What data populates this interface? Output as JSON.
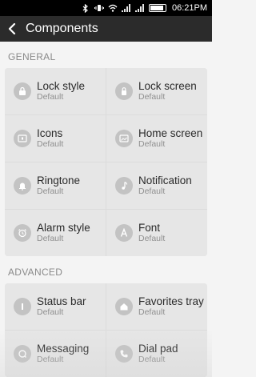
{
  "status_bar": {
    "time": "06:21PM",
    "icons": [
      "bluetooth-icon",
      "vibrate-icon",
      "wifi-icon",
      "signal-icon",
      "signal-icon",
      "battery-icon"
    ]
  },
  "header": {
    "title": "Components",
    "back_icon": "chevron-left-icon"
  },
  "sections": [
    {
      "label": "GENERAL",
      "items": [
        {
          "label": "Lock style",
          "sub": "Default",
          "icon": "lock-icon"
        },
        {
          "label": "Lock screen",
          "sub": "Default",
          "icon": "lock-screen-icon"
        },
        {
          "label": "Icons",
          "sub": "Default",
          "icon": "icons-icon"
        },
        {
          "label": "Home screen",
          "sub": "Default",
          "icon": "home-screen-icon"
        },
        {
          "label": "Ringtone",
          "sub": "Default",
          "icon": "bell-icon"
        },
        {
          "label": "Notification",
          "sub": "Default",
          "icon": "music-note-icon"
        },
        {
          "label": "Alarm style",
          "sub": "Default",
          "icon": "alarm-clock-icon"
        },
        {
          "label": "Font",
          "sub": "Default",
          "icon": "font-icon"
        }
      ]
    },
    {
      "label": "ADVANCED",
      "items": [
        {
          "label": "Status bar",
          "sub": "Default",
          "icon": "status-bar-icon"
        },
        {
          "label": "Favorites tray",
          "sub": "Default",
          "icon": "home-icon"
        },
        {
          "label": "Messaging",
          "sub": "Default",
          "icon": "message-icon"
        },
        {
          "label": "Dial pad",
          "sub": "Default",
          "icon": "phone-icon"
        }
      ]
    }
  ]
}
